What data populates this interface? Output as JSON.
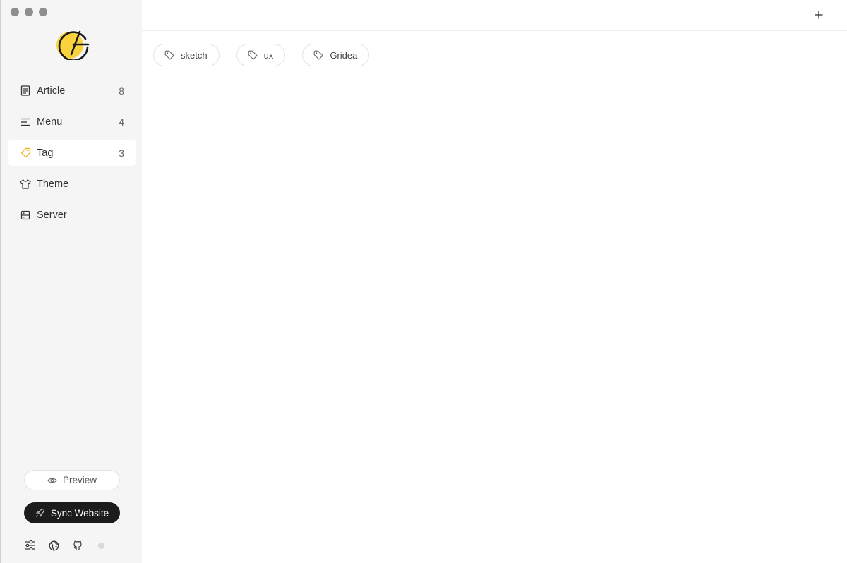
{
  "window": {
    "controls": [
      "close",
      "minimize",
      "maximize"
    ]
  },
  "brand": {
    "logo_icon": "gridea-logo-icon",
    "accent": "#f9d23c"
  },
  "sidebar": {
    "items": [
      {
        "label": "Article",
        "count": "8",
        "icon": "article-icon",
        "active": false
      },
      {
        "label": "Menu",
        "count": "4",
        "icon": "menu-icon",
        "active": false
      },
      {
        "label": "Tag",
        "count": "3",
        "icon": "tag-icon",
        "active": true
      },
      {
        "label": "Theme",
        "count": "",
        "icon": "shirt-icon",
        "active": false
      },
      {
        "label": "Server",
        "count": "",
        "icon": "server-icon",
        "active": false
      }
    ],
    "preview_label": "Preview",
    "sync_label": "Sync Website",
    "footer_icons": [
      "settings-sliders-icon",
      "globe-icon",
      "github-icon"
    ]
  },
  "main": {
    "add_icon": "plus-icon",
    "tags": [
      {
        "label": "sketch"
      },
      {
        "label": "ux"
      },
      {
        "label": "Gridea"
      }
    ]
  }
}
